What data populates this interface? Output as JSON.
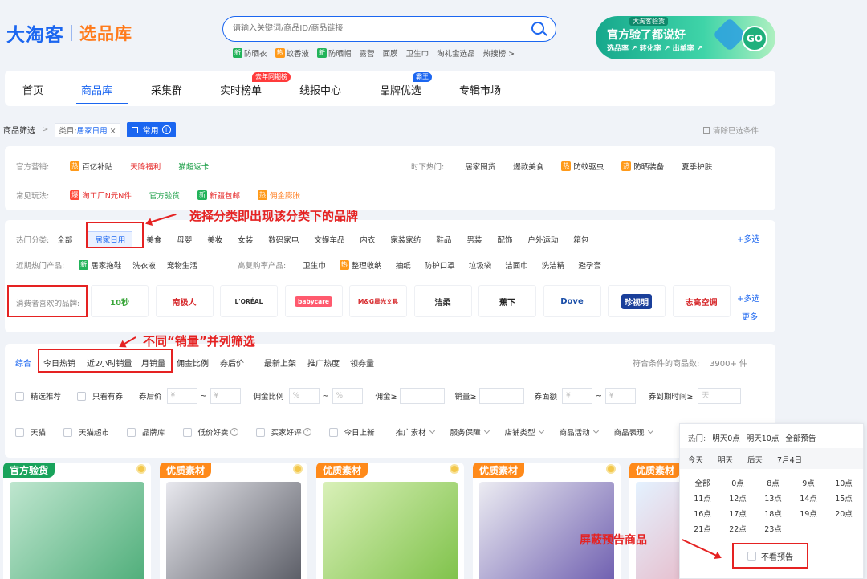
{
  "header": {
    "logo_main": "大淘客",
    "logo_sub": "选品库",
    "search_placeholder": "请输入关键词/商品ID/商品链接",
    "hotwords": [
      {
        "tag": "新",
        "text": "防晒衣",
        "kind": "new"
      },
      {
        "tag": "热",
        "text": "蚊香液",
        "kind": "hot"
      },
      {
        "tag": "新",
        "text": "防晒帽",
        "kind": "new"
      },
      {
        "tag": "",
        "text": "露营",
        "kind": ""
      },
      {
        "tag": "",
        "text": "面膜",
        "kind": ""
      },
      {
        "tag": "",
        "text": "卫生巾",
        "kind": ""
      },
      {
        "tag": "",
        "text": "淘礼金选品",
        "kind": ""
      },
      {
        "tag": "",
        "text": "热搜榜 >",
        "kind": ""
      }
    ],
    "banner": {
      "tag": "大淘客验货",
      "title": "官方验了都说好",
      "subtitle": "选品率 ↗  转化率 ↗  出单率 ↗",
      "go": "GO"
    }
  },
  "nav": {
    "items": [
      "首页",
      "商品库",
      "采集群",
      "实时榜单",
      "线报中心",
      "品牌优选",
      "专辑市场"
    ],
    "badge_rank": "去年同期榜",
    "badge_brand": "霸王"
  },
  "crumb": {
    "root": "商品筛选",
    "sep": ">",
    "category_label": "类目:",
    "category_value": "居家日用",
    "close": "×",
    "common": "常用",
    "info": "i",
    "clear": "清除已选条件"
  },
  "marketing": {
    "official_label": "官方营销:",
    "official": [
      {
        "tag": "热",
        "text": "百亿补贴"
      },
      {
        "tag": "",
        "text": "天降福利",
        "color": "red"
      },
      {
        "tag": "",
        "text": "猫超返卡",
        "color": "green"
      }
    ],
    "trend_label": "时下热门:",
    "trend": [
      {
        "tag": "",
        "text": "居家囤货"
      },
      {
        "tag": "",
        "text": "爆款美食"
      },
      {
        "tag": "热",
        "text": "防蚊驱虫"
      },
      {
        "tag": "热",
        "text": "防晒装备"
      },
      {
        "tag": "",
        "text": "夏季护肤"
      }
    ],
    "play_label": "常见玩法:",
    "play": [
      {
        "tag": "爆",
        "text": "淘工厂N元N件",
        "color": "red"
      },
      {
        "tag": "",
        "text": "官方验货",
        "color": "green"
      },
      {
        "tag": "新",
        "text": "新疆包邮",
        "color": "red"
      },
      {
        "tag": "热",
        "text": "佣金膨胀",
        "color": "orange"
      }
    ]
  },
  "category": {
    "hot_label": "热门分类:",
    "items": [
      "全部",
      "居家日用",
      "美食",
      "母婴",
      "美妆",
      "女装",
      "数码家电",
      "文娱车品",
      "内衣",
      "家装家纺",
      "鞋品",
      "男装",
      "配饰",
      "户外运动",
      "箱包"
    ],
    "more": "+多选",
    "recent_label": "近期热门产品:",
    "recent": [
      {
        "tag": "新",
        "text": "居家拖鞋"
      },
      {
        "tag": "",
        "text": "洗衣液"
      },
      {
        "tag": "",
        "text": "宠物生活"
      }
    ],
    "repurchase_label": "高复购率产品:",
    "repurchase": [
      {
        "tag": "",
        "text": "卫生巾"
      },
      {
        "tag": "热",
        "text": "整理收纳"
      },
      {
        "tag": "",
        "text": "抽纸"
      },
      {
        "tag": "",
        "text": "防护口罩"
      },
      {
        "tag": "",
        "text": "垃圾袋"
      },
      {
        "tag": "",
        "text": "洁面巾"
      },
      {
        "tag": "",
        "text": "洗洁精"
      },
      {
        "tag": "",
        "text": "避孕套"
      }
    ],
    "brand_label": "消费者喜欢的品牌:",
    "brands": [
      {
        "text": "10秒",
        "color": "#3aa63a"
      },
      {
        "text": "南极人",
        "color": "#d6282b"
      },
      {
        "text": "L'ORÉAL",
        "color": "#333333"
      },
      {
        "text": "babycare",
        "color": "#ffffff"
      },
      {
        "text": "M&G晨光文具",
        "color": "#d6282b"
      },
      {
        "text": "洁柔",
        "color": "#333333"
      },
      {
        "text": "蕉下",
        "color": "#222222"
      },
      {
        "text": "Dove",
        "color": "#1a4ea8"
      },
      {
        "text": "珍视明",
        "color": "#ffffff"
      },
      {
        "text": "志高空调",
        "color": "#d6282b"
      }
    ],
    "brand_more_select": "+多选",
    "brand_more": "更多",
    "annot": "选择分类即出现该分类下的品牌"
  },
  "sort": {
    "items": [
      "综合",
      "今日热销",
      "近2小时销量",
      "月销量",
      "佣金比例",
      "券后价",
      "最新上架",
      "推广热度",
      "领券量"
    ],
    "count_label": "符合条件的商品数:",
    "count": "3900+ 件",
    "annot": "不同“销量”并列筛选",
    "filters1": {
      "jingxuan": "精选推荐",
      "youquan": "只看有券",
      "after_price": "券后价",
      "yen": "¥",
      "tilde": "~",
      "ratio": "佣金比例",
      "pct": "%",
      "commission": "佣金≥",
      "sales": "销量≥",
      "coupon": "券面额",
      "expire": "券到期时间≥",
      "days": "天"
    },
    "filters2": {
      "tmall": "天猫",
      "tmall_super": "天猫超市",
      "brand_lib": "品牌库",
      "low_price": "低价好卖",
      "good_review": "买家好评",
      "today_new": "今日上新",
      "promo_material": "推广素材",
      "service": "服务保障",
      "shop_type": "店铺类型",
      "activity": "商品活动",
      "performance": "商品表现"
    }
  },
  "products": [
    {
      "tag": "官方验货",
      "tag_color": "#19a35b"
    },
    {
      "tag": "优质素材",
      "tag_color": "#ff8a1a"
    },
    {
      "tag": "优质素材",
      "tag_color": "#ff8a1a"
    },
    {
      "tag": "优质素材",
      "tag_color": "#ff8a1a"
    },
    {
      "tag": "优质素材",
      "tag_color": "#ff8a1a"
    }
  ],
  "popover": {
    "hot_label": "热门:",
    "hot": [
      "明天0点",
      "明天10点",
      "全部预告"
    ],
    "days": [
      "今天",
      "明天",
      "后天",
      "7月4日"
    ],
    "hours": [
      "全部",
      "0点",
      "8点",
      "9点",
      "10点",
      "11点",
      "12点",
      "13点",
      "14点",
      "15点",
      "16点",
      "17点",
      "18点",
      "19点",
      "20点",
      "21点",
      "22点",
      "23点"
    ],
    "no_preview": "不看预告",
    "annot": "屏蔽预告商品"
  }
}
